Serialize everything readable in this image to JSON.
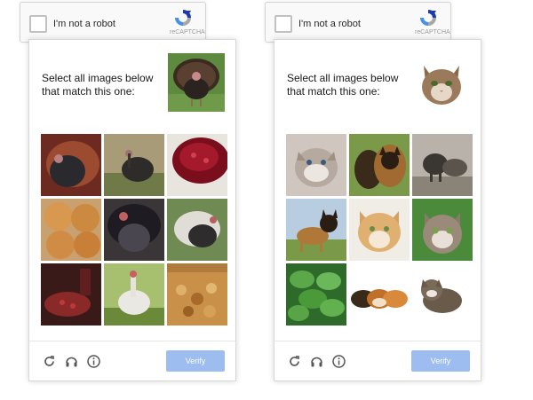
{
  "widgets": [
    {
      "anchor": {
        "label": "I'm not a robot",
        "brand": "reCAPTCHA"
      },
      "instruction_line1": "Select all images below",
      "instruction_line2": "that match this one:",
      "sample_icon": "turkey",
      "tiles": [
        "turkey",
        "turkey",
        "cranberry-sauce",
        "bread-rolls",
        "turkey",
        "turkey",
        "cranberry-sauce",
        "turkey",
        "stuffing"
      ],
      "footer": {
        "icons": [
          "reload-icon",
          "audio-icon",
          "info-icon"
        ],
        "verify_label": "Verify"
      }
    },
    {
      "anchor": {
        "label": "I'm not a robot",
        "brand": "reCAPTCHA"
      },
      "instruction_line1": "Select all images below",
      "instruction_line2": "that match this one:",
      "sample_icon": "cat",
      "tiles": [
        "kitten",
        "dogs",
        "dogs",
        "dog",
        "kitten",
        "kitten",
        "plant",
        "guinea-pigs",
        "kitten"
      ],
      "footer": {
        "icons": [
          "reload-icon",
          "audio-icon",
          "info-icon"
        ],
        "verify_label": "Verify"
      }
    }
  ],
  "colors": {
    "verify_button": "#9dbcf0",
    "recaptcha_blue": "#1c3aa9",
    "recaptcha_light_blue": "#4a90e2",
    "recaptcha_grey": "#a6a6a6"
  }
}
